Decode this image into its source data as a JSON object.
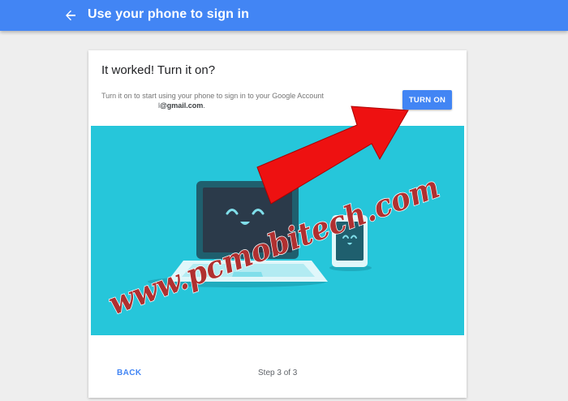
{
  "header": {
    "title": "Use your phone to sign in",
    "back_icon": "arrow-back-icon"
  },
  "card": {
    "title": "It worked! Turn it on?",
    "description": "Turn it on to start using your phone to sign in to your Google Account",
    "email_prefix": "l",
    "email_domain": "@gmail.com",
    "email_suffix": ".",
    "turn_on_label": "TURN ON",
    "back_label": "BACK",
    "step_label": "Step 3 of 3"
  },
  "watermark": {
    "text": "www.pcmobitech.com"
  },
  "colors": {
    "header": "#4285f4",
    "accent": "#4285f4",
    "illustration_bg": "#26c6da",
    "arrow": "#ee1111",
    "watermark": "#b03030"
  }
}
